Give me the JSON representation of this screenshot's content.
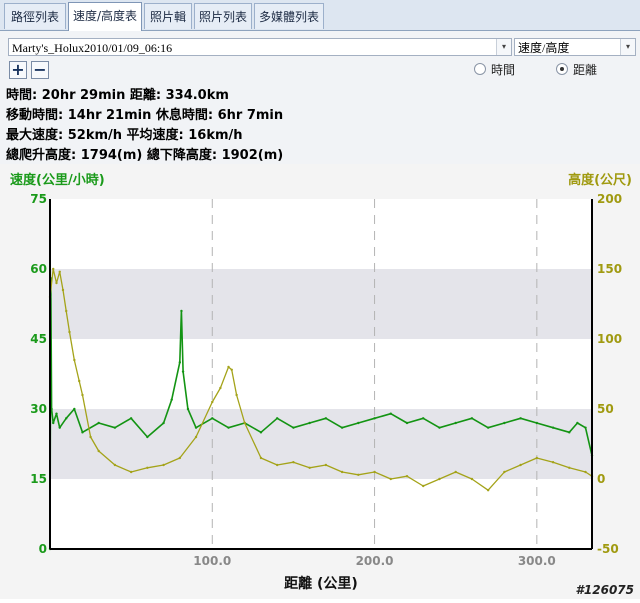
{
  "tabs": [
    {
      "label": "路徑列表",
      "active": false
    },
    {
      "label": "速度/高度表",
      "active": true
    },
    {
      "label": "照片輯",
      "active": false
    },
    {
      "label": "照片列表",
      "active": false
    },
    {
      "label": "多媒體列表",
      "active": false
    }
  ],
  "track_select": {
    "value": "Marty's_Holux2010/01/09_06:16"
  },
  "mode_select": {
    "value": "速度/高度"
  },
  "zoom": {
    "in_label": "+",
    "out_label": "−"
  },
  "axis_mode": {
    "time_label": "時間",
    "distance_label": "距離",
    "selected": "distance"
  },
  "stats": [
    "時間: 20hr 29min   距離: 334.0km",
    "移動時間: 14hr 21min   休息時間: 6hr 7min",
    "最大速度: 52km/h   平均速度: 16km/h",
    "總爬升高度: 1794(m)   總下降高度: 1902(m)"
  ],
  "watermark": "#126075",
  "colors": {
    "speed": "#139413",
    "elevation": "#a4a319",
    "axis_text_left": "#1a9a1a",
    "axis_text_right": "#a09a10"
  },
  "chart_data": {
    "type": "line",
    "xlabel": "距離 (公里)",
    "ylabel_left": "速度(公里/小時)",
    "ylabel_right": "高度(公尺)",
    "xlim": [
      0,
      334
    ],
    "ylim_left": [
      0,
      75
    ],
    "ylim_right": [
      -50,
      200
    ],
    "x_ticks": [
      "100.0",
      "200.0",
      "300.0"
    ],
    "y_ticks_left": [
      "0",
      "15",
      "30",
      "45",
      "60",
      "75"
    ],
    "y_ticks_right": [
      "-50",
      "0",
      "50",
      "100",
      "150",
      "200"
    ],
    "series": [
      {
        "name": "速度",
        "axis": "left",
        "x": [
          0,
          0.5,
          1,
          2,
          4,
          6,
          10,
          15,
          20,
          30,
          40,
          50,
          60,
          70,
          75,
          80,
          81,
          82,
          85,
          90,
          100,
          110,
          120,
          130,
          140,
          150,
          160,
          170,
          180,
          190,
          200,
          210,
          220,
          230,
          240,
          250,
          260,
          270,
          280,
          290,
          300,
          310,
          320,
          325,
          330,
          334
        ],
        "values": [
          0,
          58,
          30,
          27,
          29,
          26,
          28,
          30,
          25,
          27,
          26,
          28,
          24,
          27,
          32,
          40,
          51,
          38,
          30,
          26,
          28,
          26,
          27,
          25,
          28,
          26,
          27,
          28,
          26,
          27,
          28,
          29,
          27,
          28,
          26,
          27,
          28,
          26,
          27,
          28,
          27,
          26,
          25,
          27,
          26,
          20
        ]
      },
      {
        "name": "高度",
        "axis": "right",
        "x": [
          0,
          2,
          4,
          6,
          8,
          10,
          12,
          15,
          18,
          20,
          25,
          30,
          40,
          50,
          60,
          70,
          80,
          90,
          100,
          105,
          110,
          112,
          115,
          120,
          130,
          140,
          150,
          160,
          170,
          180,
          190,
          200,
          210,
          220,
          230,
          240,
          250,
          260,
          270,
          280,
          290,
          300,
          310,
          320,
          330,
          334
        ],
        "values": [
          130,
          150,
          140,
          148,
          135,
          120,
          105,
          85,
          70,
          60,
          30,
          20,
          10,
          5,
          8,
          10,
          15,
          30,
          55,
          65,
          80,
          78,
          60,
          40,
          15,
          10,
          12,
          8,
          10,
          5,
          3,
          5,
          0,
          2,
          -5,
          0,
          5,
          0,
          -8,
          5,
          10,
          15,
          12,
          8,
          5,
          2
        ]
      }
    ]
  }
}
